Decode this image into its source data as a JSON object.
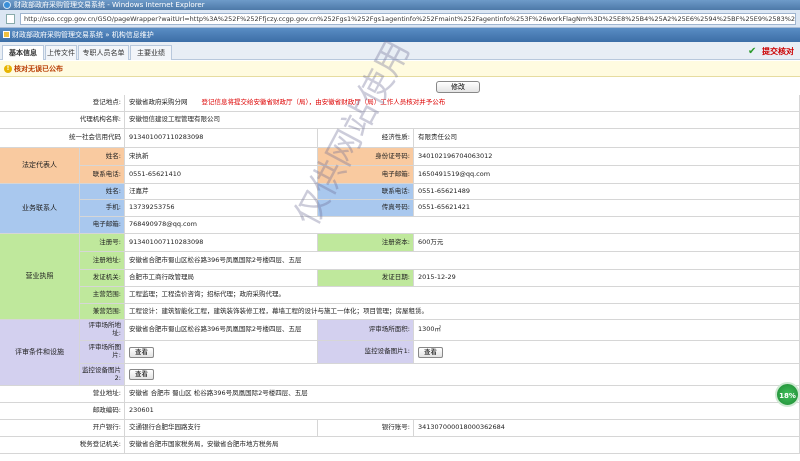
{
  "browser": {
    "title": "财政部政府采购管理交易系统 - Windows Internet Explorer",
    "url": "http://sso.ccgp.gov.cn/GSO/pageWrapper?waitUrl=http%3A%252F%252Ffjczy.ccgp.gov.cn%252Fgs1%252Fgs1agentinfo%252Fmaint%252Fagentinfo%253F%26workFlagNm%3D%25E8%25B4%25A2%25E6%2594%25BF%25E9%2583%25A8%25E6%2594%25BF"
  },
  "app": {
    "title": "财政部政府采购管理交易系统 » 机构信息维护"
  },
  "tabs": [
    "基本信息",
    "上传文件",
    "专职人员名单",
    "主要业绩"
  ],
  "submit_label": "提交核对",
  "notice": "核对无误已公布",
  "edit_label": "修改",
  "view_label": "查看",
  "form": {
    "reg_location_label": "登记地点:",
    "reg_location": "安徽省政府采购分网",
    "reg_note": "登记信息将提交给安徽省财政厅（局），由安徽省财政厅（局）工作人员核对并予公布",
    "agency_name_label": "代理机构名称:",
    "agency_name": "安徽恒信建设工程管理有限公司",
    "credit_code_label": "统一社会信用代码",
    "credit_code": "913401007110283098",
    "econ_type_label": "经济性质:",
    "econ_type": "有限责任公司",
    "legal_group": "法定代表人",
    "legal_name_label": "姓名:",
    "legal_name": "宋执新",
    "legal_id_label": "身份证号码:",
    "legal_id": "340102196704063012",
    "legal_phone_label": "联系电话:",
    "legal_phone": "0551-65621410",
    "legal_email_label": "电子邮箱:",
    "legal_email": "1650491519@qq.com",
    "biz_group": "业务联系人",
    "biz_name_label": "姓名:",
    "biz_name": "汪嘉芹",
    "biz_phone_label": "联系电话:",
    "biz_phone": "0551-65621489",
    "biz_mobile_label": "手机:",
    "biz_mobile": "13739253756",
    "biz_fax_label": "传真号码:",
    "biz_fax": "0551-65621421",
    "biz_email_label": "电子邮箱:",
    "biz_email": "768490978@qq.com",
    "license_group": "营业执照",
    "reg_no_label": "注册号:",
    "reg_no": "913401007110283098",
    "capital_label": "注册资本:",
    "capital": "600万元",
    "reg_addr_label": "注册地址:",
    "reg_addr": "安徽省合肥市蜀山区松谷路396号凤凰国际2号楼四层、五层",
    "issuer_label": "发证机关:",
    "issuer": "合肥市工商行政管理局",
    "issue_date_label": "发证日期:",
    "issue_date": "2015-12-29",
    "main_scope_label": "主营范围:",
    "main_scope": "工程监理；工程造价咨询；招标代理；政府采购代理。",
    "side_scope_label": "兼营范围:",
    "side_scope": "工程设计：建筑智能化工程，建筑装饰装修工程，幕墙工程的设计与施工一体化；项目管理；房屋租赁。",
    "review_group": "评审条件和设施",
    "review_addr_label": "评审场所地址:",
    "review_addr": "安徽省合肥市蜀山区松谷路396号凤凰国际2号楼四层、五层",
    "review_area_label": "评审场所面积:",
    "review_area": "1300㎡",
    "review_photo_label": "评审场所图片:",
    "monitor1_label": "监控设备图片1:",
    "monitor2_label": "监控设备图片2:",
    "office_addr_label": "营业地址:",
    "office_addr": "安徽省 合肥市 蜀山区 松谷路396号凤凰国际2号楼四层、五层",
    "postcode_label": "邮政编码:",
    "postcode": "230601",
    "bank_label": "开户银行:",
    "bank": "交通银行合肥华园路支行",
    "account_label": "银行账号:",
    "account": "341307000018000362684",
    "tax_label": "税务登记机关:",
    "tax": "安徽省合肥市国家税务局，安徽省合肥市地方税务局"
  },
  "watermark": "仅供网站使用",
  "progress_badge": "18%",
  "colors": {
    "legal": "#f9caa0",
    "contact": "#a9c8ee",
    "license": "#bfe89c",
    "review": "#d3d0ef",
    "alert": "#d00000"
  }
}
